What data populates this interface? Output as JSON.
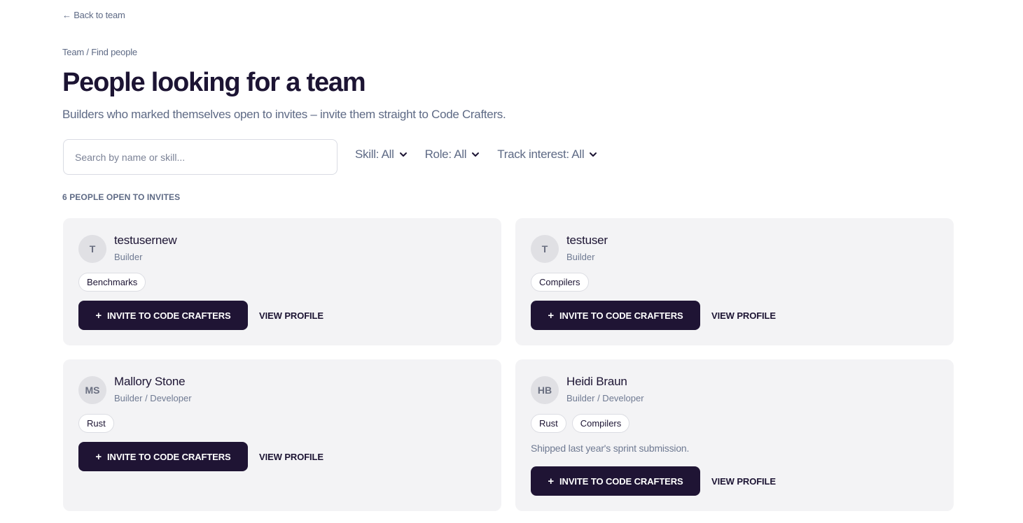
{
  "nav": {
    "back_label": "← Back to team"
  },
  "breadcrumb": "Team / Find people",
  "page": {
    "title": "People looking for a team",
    "subtitle": "Builders who marked themselves open to invites – invite them straight to Code Crafters."
  },
  "search": {
    "placeholder": "Search by name or skill..."
  },
  "filters": [
    {
      "label": "Skill: All",
      "icon": "chevron-down-icon"
    },
    {
      "label": "Role: All",
      "icon": "chevron-down-icon"
    },
    {
      "label": "Track interest: All",
      "icon": "chevron-down-icon"
    }
  ],
  "results": {
    "count_label": "6 PEOPLE OPEN TO INVITES"
  },
  "actions": {
    "invite_label": "INVITE TO CODE CRAFTERS",
    "invite_icon": "plus-icon",
    "view_label": "VIEW PROFILE"
  },
  "people": [
    {
      "initials": "T",
      "name": "testusernew",
      "role": "Builder",
      "tags": [
        "Benchmarks"
      ],
      "note": ""
    },
    {
      "initials": "T",
      "name": "testuser",
      "role": "Builder",
      "tags": [
        "Compilers"
      ],
      "note": ""
    },
    {
      "initials": "MS",
      "name": "Mallory Stone",
      "role": "Builder / Developer",
      "tags": [
        "Rust"
      ],
      "note": ""
    },
    {
      "initials": "HB",
      "name": "Heidi Braun",
      "role": "Builder / Developer",
      "tags": [
        "Rust",
        "Compilers"
      ],
      "note": "Shipped last year's sprint submission."
    }
  ],
  "colors": {
    "primary": "#1f1434",
    "muted_text": "#5e6a85",
    "card_bg": "#f3f3f5"
  }
}
